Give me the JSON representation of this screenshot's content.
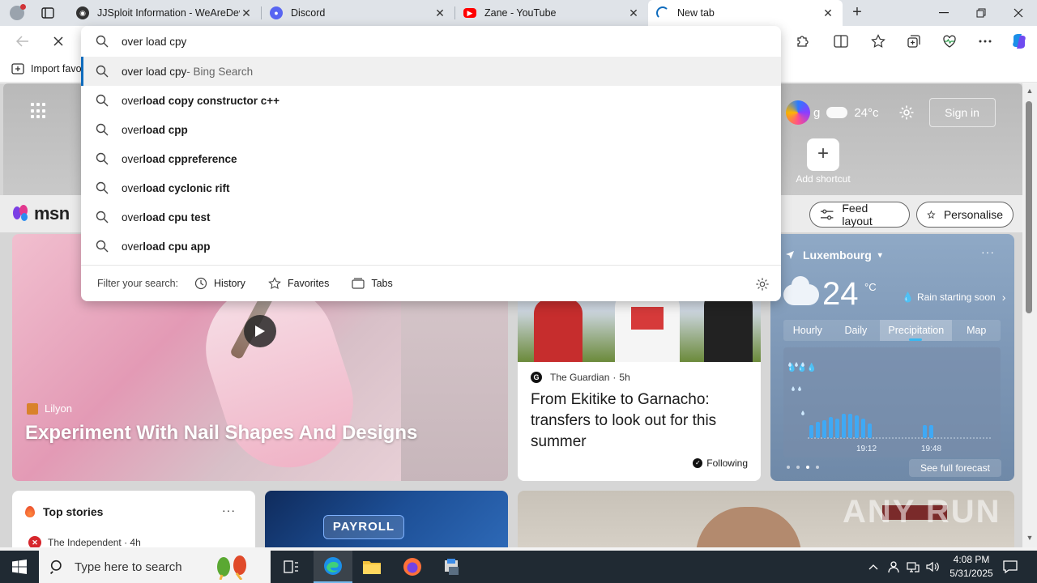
{
  "tabs": [
    {
      "title": "JJSploit Information - WeAreDevs",
      "favicon": "wearedevs-icon"
    },
    {
      "title": "Discord",
      "favicon": "discord-icon",
      "color": "#5865f2"
    },
    {
      "title": "Zane - YouTube",
      "favicon": "youtube-icon",
      "color": "#ff0000"
    },
    {
      "title": "New tab",
      "favicon": "loading-spinner-icon",
      "active": true
    }
  ],
  "favorites_bar": {
    "import_label": "Import favo"
  },
  "omnibox": {
    "query": "over load cpy",
    "suggestions": [
      {
        "prefix": "over load cpy",
        "bold": "",
        "suffix": " - Bing Search",
        "selected": true
      },
      {
        "prefix": "over",
        "bold": "load copy constructor c++",
        "suffix": ""
      },
      {
        "prefix": "over",
        "bold": "load cpp",
        "suffix": ""
      },
      {
        "prefix": "over",
        "bold": "load cppreference",
        "suffix": ""
      },
      {
        "prefix": "over",
        "bold": "load cyclonic rift",
        "suffix": ""
      },
      {
        "prefix": "over",
        "bold": "load cpu test",
        "suffix": ""
      },
      {
        "prefix": "over",
        "bold": "load cpu app",
        "suffix": ""
      }
    ],
    "filter_label": "Filter your search:",
    "filters": [
      "History",
      "Favorites",
      "Tabs"
    ]
  },
  "header": {
    "partial_text": "g",
    "weather_temp": "24°c",
    "sign_in": "Sign in",
    "add_shortcut": "Add shortcut"
  },
  "msn_bar": {
    "logo_text": "msn",
    "feed_layout": "Feed layout",
    "personalise": "Personalise"
  },
  "hero_card": {
    "source": "Lilyon",
    "title": "Experiment With Nail Shapes And Designs"
  },
  "news_card": {
    "source": "The Guardian",
    "age": "5h",
    "title": "From Ekitike to Garnacho: transfers to look out for this summer",
    "following": "Following"
  },
  "weather_card": {
    "location": "Luxembourg",
    "temp": "24",
    "unit": "°C",
    "rain_note": "Rain starting soon",
    "tabs": [
      "Hourly",
      "Daily",
      "Precipitation",
      "Map"
    ],
    "active_tab": "Precipitation",
    "time_labels": [
      "19:12",
      "19:48"
    ],
    "see_forecast": "See full forecast"
  },
  "top_stories": {
    "heading": "Top stories",
    "source": "The Independent · 4h"
  },
  "payroll_card": {
    "label": "PAYROLL"
  },
  "watermark": "ANY RUN",
  "taskbar": {
    "search_placeholder": "Type here to search",
    "time": "4:08 PM",
    "date": "5/31/2025"
  }
}
